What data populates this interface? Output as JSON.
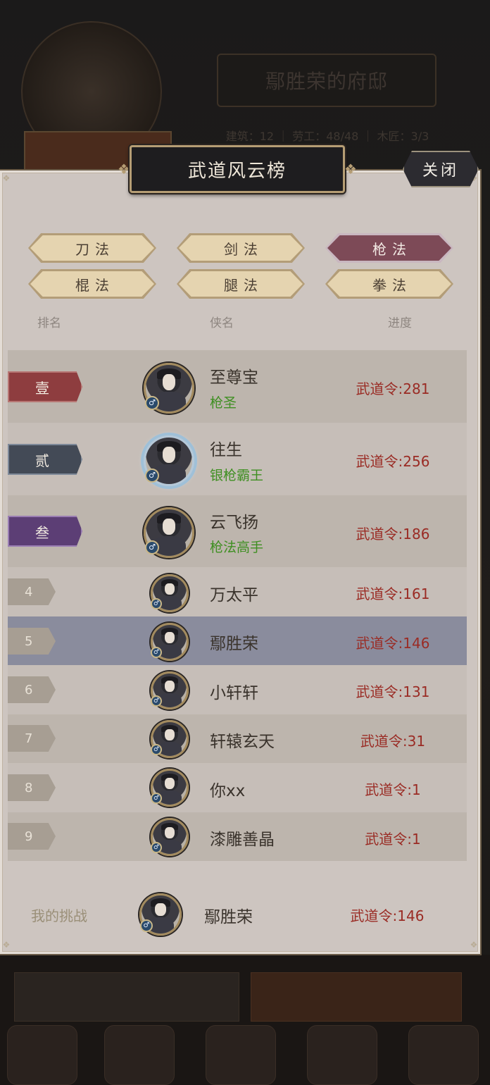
{
  "background": {
    "mansion_title": "鄢胜荣的府邸",
    "stats_text": "建筑：12 ｜ 劳工：48/48 ｜ 木匠：3/3"
  },
  "header": {
    "title": "武道风云榜",
    "close_label": "关闭"
  },
  "tabs": [
    {
      "label": "刀法",
      "active": false
    },
    {
      "label": "剑法",
      "active": false
    },
    {
      "label": "枪法",
      "active": true
    },
    {
      "label": "棍法",
      "active": false
    },
    {
      "label": "腿法",
      "active": false
    },
    {
      "label": "拳法",
      "active": false
    }
  ],
  "columns": {
    "rank": "排名",
    "name": "侠名",
    "progress": "进度"
  },
  "rows": [
    {
      "rank": "壹",
      "name": "至尊宝",
      "title": "枪圣",
      "score": "武道令:281"
    },
    {
      "rank": "贰",
      "name": "往生",
      "title": "银枪霸王",
      "score": "武道令:256"
    },
    {
      "rank": "叁",
      "name": "云飞扬",
      "title": "枪法高手",
      "score": "武道令:186"
    },
    {
      "rank": "4",
      "name": "万太平",
      "title": "",
      "score": "武道令:161"
    },
    {
      "rank": "5",
      "name": "鄢胜荣",
      "title": "",
      "score": "武道令:146"
    },
    {
      "rank": "6",
      "name": "小轩轩",
      "title": "",
      "score": "武道令:131"
    },
    {
      "rank": "7",
      "name": "轩辕玄天",
      "title": "",
      "score": "武道令:31"
    },
    {
      "rank": "8",
      "name": "你xx",
      "title": "",
      "score": "武道令:1"
    },
    {
      "rank": "9",
      "name": "漆雕善晶",
      "title": "",
      "score": "武道令:1"
    }
  ],
  "my_challenge": {
    "label": "我的挑战",
    "name": "鄢胜荣",
    "score": "武道令:146"
  },
  "gender_symbol": "♂"
}
